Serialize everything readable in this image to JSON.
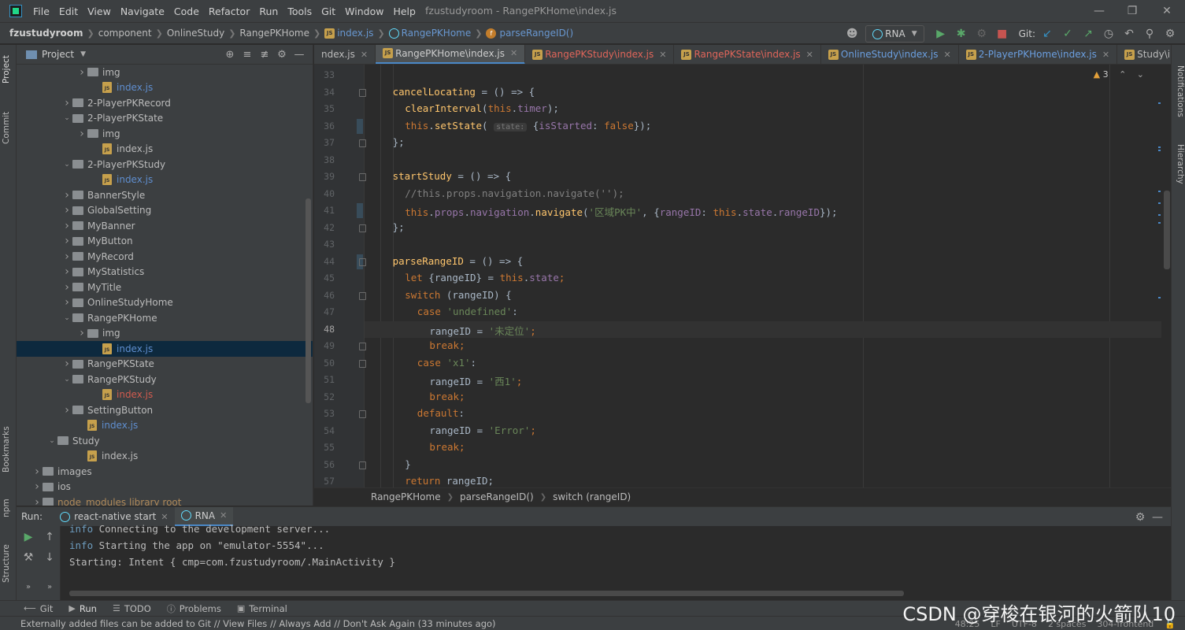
{
  "menu": {
    "items": [
      "File",
      "Edit",
      "View",
      "Navigate",
      "Code",
      "Refactor",
      "Run",
      "Tools",
      "Git",
      "Window",
      "Help"
    ],
    "window_title": "fzustudyroom - RangePKHome\\index.js"
  },
  "navbar": {
    "crumbs": [
      "fzustudyroom",
      "component",
      "OnlineStudy",
      "RangePKHome",
      "index.js",
      "RangePKHome",
      "parseRangeID()"
    ],
    "run_config": "RNA",
    "git_label": "Git:"
  },
  "left_stripe": {
    "project": "Project",
    "commit": "Commit",
    "bookmarks": "Bookmarks",
    "npm": "npm",
    "structure": "Structure"
  },
  "right_stripe": {
    "notifications": "Notifications",
    "hierarchy": "Hierarchy"
  },
  "project_panel": {
    "title": "Project",
    "tree": [
      {
        "label": "img",
        "indent": 5,
        "arrow": "right",
        "type": "folder",
        "color": ""
      },
      {
        "label": "index.js",
        "indent": 6,
        "arrow": "",
        "type": "file",
        "color": "blue"
      },
      {
        "label": "2-PlayerPKRecord",
        "indent": 4,
        "arrow": "right",
        "type": "folder",
        "color": ""
      },
      {
        "label": "2-PlayerPKState",
        "indent": 4,
        "arrow": "down",
        "type": "folder",
        "color": ""
      },
      {
        "label": "img",
        "indent": 5,
        "arrow": "right",
        "type": "folder",
        "color": ""
      },
      {
        "label": "index.js",
        "indent": 6,
        "arrow": "",
        "type": "file",
        "color": ""
      },
      {
        "label": "2-PlayerPKStudy",
        "indent": 4,
        "arrow": "down",
        "type": "folder",
        "color": ""
      },
      {
        "label": "index.js",
        "indent": 6,
        "arrow": "",
        "type": "file",
        "color": "blue"
      },
      {
        "label": "BannerStyle",
        "indent": 4,
        "arrow": "right",
        "type": "folder",
        "color": ""
      },
      {
        "label": "GlobalSetting",
        "indent": 4,
        "arrow": "right",
        "type": "folder",
        "color": ""
      },
      {
        "label": "MyBanner",
        "indent": 4,
        "arrow": "right",
        "type": "folder",
        "color": ""
      },
      {
        "label": "MyButton",
        "indent": 4,
        "arrow": "right",
        "type": "folder",
        "color": ""
      },
      {
        "label": "MyRecord",
        "indent": 4,
        "arrow": "right",
        "type": "folder",
        "color": ""
      },
      {
        "label": "MyStatistics",
        "indent": 4,
        "arrow": "right",
        "type": "folder",
        "color": ""
      },
      {
        "label": "MyTitle",
        "indent": 4,
        "arrow": "right",
        "type": "folder",
        "color": ""
      },
      {
        "label": "OnlineStudyHome",
        "indent": 4,
        "arrow": "right",
        "type": "folder",
        "color": ""
      },
      {
        "label": "RangePKHome",
        "indent": 4,
        "arrow": "down",
        "type": "folder",
        "color": ""
      },
      {
        "label": "img",
        "indent": 5,
        "arrow": "right",
        "type": "folder",
        "color": ""
      },
      {
        "label": "index.js",
        "indent": 6,
        "arrow": "",
        "type": "file",
        "color": "blue",
        "selected": true
      },
      {
        "label": "RangePKState",
        "indent": 4,
        "arrow": "right",
        "type": "folder",
        "color": ""
      },
      {
        "label": "RangePKStudy",
        "indent": 4,
        "arrow": "down",
        "type": "folder",
        "color": ""
      },
      {
        "label": "index.js",
        "indent": 6,
        "arrow": "",
        "type": "file",
        "color": "red"
      },
      {
        "label": "SettingButton",
        "indent": 4,
        "arrow": "right",
        "type": "folder",
        "color": ""
      },
      {
        "label": "index.js",
        "indent": 5,
        "arrow": "",
        "type": "file",
        "color": "blue"
      },
      {
        "label": "Study",
        "indent": 3,
        "arrow": "down",
        "type": "folder",
        "color": ""
      },
      {
        "label": "index.js",
        "indent": 5,
        "arrow": "",
        "type": "file",
        "color": ""
      },
      {
        "label": "images",
        "indent": 2,
        "arrow": "right",
        "type": "folder",
        "color": ""
      },
      {
        "label": "ios",
        "indent": 2,
        "arrow": "right",
        "type": "folder",
        "color": ""
      },
      {
        "label": "node_modules  library root",
        "indent": 2,
        "arrow": "right",
        "type": "folder",
        "color": "dim"
      }
    ]
  },
  "editor_tabs": [
    {
      "label": "ndex.js",
      "state": "partial"
    },
    {
      "label": "RangePKHome\\index.js",
      "state": "active"
    },
    {
      "label": "RangePKStudy\\index.js",
      "state": "err"
    },
    {
      "label": "RangePKState\\index.js",
      "state": "err"
    },
    {
      "label": "OnlineStudy\\index.js",
      "state": "blue"
    },
    {
      "label": "2-PlayerPKHome\\index.js",
      "state": "blue"
    },
    {
      "label": "Study\\index.js",
      "state": "normal"
    }
  ],
  "editor": {
    "warnings": "3",
    "current_line": 48,
    "lines": [
      {
        "n": 33,
        "indent": 0,
        "tokens": []
      },
      {
        "n": 34,
        "indent": 2,
        "tokens": [
          [
            "fn",
            "cancelLocating"
          ],
          [
            "",
            " = () => {"
          ]
        ]
      },
      {
        "n": 35,
        "indent": 4,
        "tokens": [
          [
            "fn",
            "clearInterval"
          ],
          [
            "",
            "("
          ],
          [
            "kw",
            "this"
          ],
          [
            "",
            "."
          ],
          [
            "prop",
            "timer"
          ],
          [
            "",
            ");"
          ]
        ]
      },
      {
        "n": 36,
        "indent": 4,
        "tokens": [
          [
            "kw",
            "this"
          ],
          [
            "",
            "."
          ],
          [
            "fn",
            "setState"
          ],
          [
            "",
            "( "
          ],
          [
            "hint",
            "state:"
          ],
          [
            "",
            " {"
          ],
          [
            "prop",
            "isStarted"
          ],
          [
            "",
            ": "
          ],
          [
            "kw",
            "false"
          ],
          [
            "",
            "});"
          ]
        ]
      },
      {
        "n": 37,
        "indent": 2,
        "tokens": [
          [
            "",
            "};"
          ]
        ]
      },
      {
        "n": 38,
        "indent": 0,
        "tokens": []
      },
      {
        "n": 39,
        "indent": 2,
        "tokens": [
          [
            "fn",
            "startStudy"
          ],
          [
            "",
            " = () => {"
          ]
        ]
      },
      {
        "n": 40,
        "indent": 4,
        "tokens": [
          [
            "cm",
            "//this.props.navigation.navigate('');"
          ]
        ]
      },
      {
        "n": 41,
        "indent": 4,
        "tokens": [
          [
            "kw",
            "this"
          ],
          [
            "",
            "."
          ],
          [
            "prop",
            "props"
          ],
          [
            "",
            "."
          ],
          [
            "prop",
            "navigation"
          ],
          [
            "",
            "."
          ],
          [
            "fn",
            "navigate"
          ],
          [
            "",
            "("
          ],
          [
            "str",
            "'区域PK中'"
          ],
          [
            "",
            ", {"
          ],
          [
            "prop",
            "rangeID"
          ],
          [
            "",
            ": "
          ],
          [
            "kw",
            "this"
          ],
          [
            "",
            "."
          ],
          [
            "prop",
            "state"
          ],
          [
            "",
            "."
          ],
          [
            "prop",
            "rangeID"
          ],
          [
            "",
            "});"
          ]
        ]
      },
      {
        "n": 42,
        "indent": 2,
        "tokens": [
          [
            "",
            "};"
          ]
        ]
      },
      {
        "n": 43,
        "indent": 0,
        "tokens": []
      },
      {
        "n": 44,
        "indent": 2,
        "tokens": [
          [
            "fn",
            "parseRangeID"
          ],
          [
            "",
            " = () => {"
          ]
        ]
      },
      {
        "n": 45,
        "indent": 4,
        "tokens": [
          [
            "kw",
            "let"
          ],
          [
            "",
            " {rangeID} = "
          ],
          [
            "kw",
            "this"
          ],
          [
            "",
            "."
          ],
          [
            "prop",
            "state"
          ],
          [
            "kw",
            ";"
          ]
        ]
      },
      {
        "n": 46,
        "indent": 4,
        "tokens": [
          [
            "kw",
            "switch"
          ],
          [
            "",
            " (rangeID) {"
          ]
        ]
      },
      {
        "n": 47,
        "indent": 6,
        "tokens": [
          [
            "kw",
            "case"
          ],
          [
            "",
            " "
          ],
          [
            "str",
            "'undefined'"
          ],
          [
            "",
            ":"
          ]
        ]
      },
      {
        "n": 48,
        "indent": 8,
        "tokens": [
          [
            "",
            "rangeID = "
          ],
          [
            "str",
            "'未定位'"
          ],
          [
            "kw",
            ";"
          ]
        ]
      },
      {
        "n": 49,
        "indent": 8,
        "tokens": [
          [
            "kw",
            "break;"
          ]
        ]
      },
      {
        "n": 50,
        "indent": 6,
        "tokens": [
          [
            "kw",
            "case"
          ],
          [
            "",
            " "
          ],
          [
            "str",
            "'x1'"
          ],
          [
            "",
            ":"
          ]
        ]
      },
      {
        "n": 51,
        "indent": 8,
        "tokens": [
          [
            "",
            "rangeID = "
          ],
          [
            "str",
            "'西1'"
          ],
          [
            "kw",
            ";"
          ]
        ]
      },
      {
        "n": 52,
        "indent": 8,
        "tokens": [
          [
            "kw",
            "break;"
          ]
        ]
      },
      {
        "n": 53,
        "indent": 6,
        "tokens": [
          [
            "kw",
            "default"
          ],
          [
            "",
            ":"
          ]
        ]
      },
      {
        "n": 54,
        "indent": 8,
        "tokens": [
          [
            "",
            "rangeID = "
          ],
          [
            "str",
            "'Error'"
          ],
          [
            "kw",
            ";"
          ]
        ]
      },
      {
        "n": 55,
        "indent": 8,
        "tokens": [
          [
            "kw",
            "break;"
          ]
        ]
      },
      {
        "n": 56,
        "indent": 4,
        "tokens": [
          [
            "",
            "}"
          ]
        ]
      },
      {
        "n": 57,
        "indent": 4,
        "tokens": [
          [
            "kw",
            "return"
          ],
          [
            "",
            " rangeID;"
          ]
        ]
      }
    ],
    "breadcrumb": [
      "RangePKHome",
      "parseRangeID()",
      "switch (rangeID)"
    ]
  },
  "run_panel": {
    "label": "Run:",
    "tabs": [
      {
        "label": "react-native start",
        "active": false
      },
      {
        "label": "RNA",
        "active": true
      }
    ],
    "console": [
      {
        "prefix": "info",
        "text": " Connecting to the development server..."
      },
      {
        "prefix": "info",
        "text": " Starting the app on \"emulator-5554\"..."
      },
      {
        "prefix": "",
        "text": "Starting: Intent { cmp=com.fzustudyroom/.MainActivity }"
      }
    ]
  },
  "bottom_tabs": [
    {
      "label": "Git",
      "icon": "git-icon"
    },
    {
      "label": "Run",
      "icon": "run-icon",
      "active": true
    },
    {
      "label": "TODO",
      "icon": "todo-icon"
    },
    {
      "label": "Problems",
      "icon": "problems-icon"
    },
    {
      "label": "Terminal",
      "icon": "terminal-icon"
    }
  ],
  "status": {
    "message": "Externally added files can be added to Git // View Files // Always Add // Don't Ask Again (33 minutes ago)",
    "position": "48:25",
    "line_sep": "LF",
    "encoding": "UTF-8",
    "indent": "2 spaces",
    "branch": "304-frontend"
  },
  "watermark": "CSDN @穿梭在银河的火箭队10",
  "colors": {
    "accent": "#4a88c7",
    "keyword": "#cc7832",
    "string": "#6a8759",
    "function": "#ffc66d",
    "property": "#9876aa"
  }
}
